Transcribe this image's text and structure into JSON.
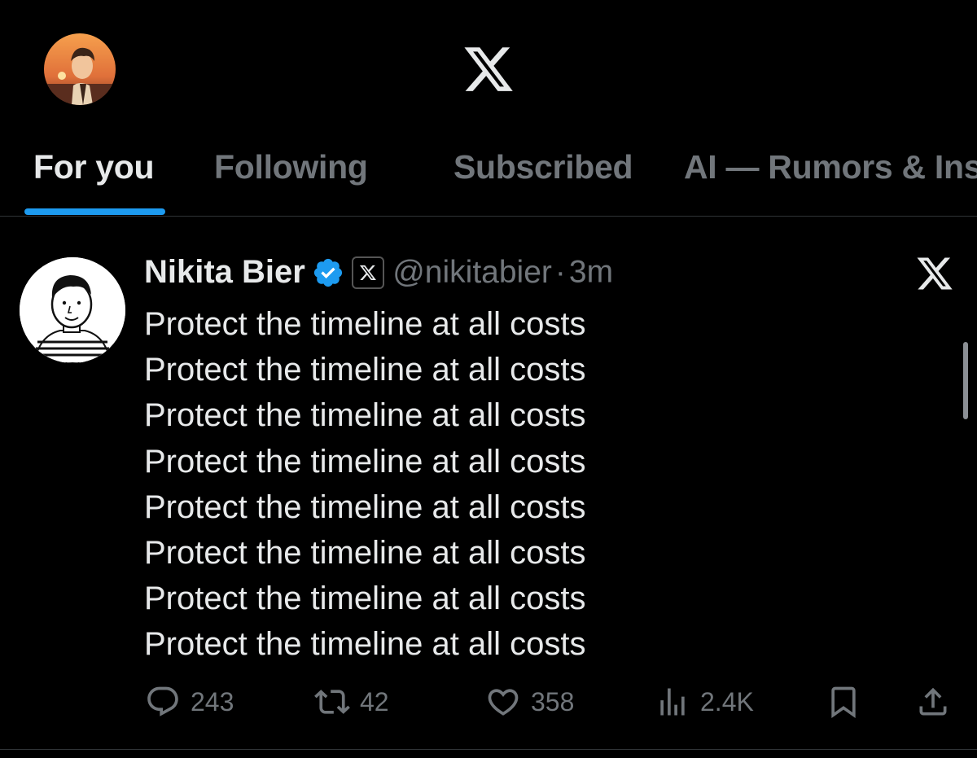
{
  "tabs": [
    {
      "label": "For you"
    },
    {
      "label": "Following"
    },
    {
      "label": "Subscribed"
    },
    {
      "label": "AI — Rumors & Ins"
    }
  ],
  "tweet": {
    "author_name": "Nikita Bier",
    "handle": "@nikitabier",
    "separator": "·",
    "time": "3m",
    "lines": [
      "Protect the timeline at all costs",
      "Protect the timeline at all costs",
      "Protect the timeline at all costs",
      "Protect the timeline at all costs",
      "Protect the timeline at all costs",
      "Protect the timeline at all costs",
      "Protect the timeline at all costs",
      "Protect the timeline at all costs"
    ],
    "actions": {
      "replies": "243",
      "reposts": "42",
      "likes": "358",
      "views": "2.4K"
    }
  },
  "icons": {
    "logo": "x-logo-icon",
    "verified": "verified-badge-icon",
    "affiliate": "x-affiliate-badge-icon",
    "grok": "x-grok-icon",
    "reply": "reply-icon",
    "repost": "repost-icon",
    "like": "heart-icon",
    "views": "views-chart-icon",
    "bookmark": "bookmark-icon",
    "share": "share-icon"
  },
  "colors": {
    "background": "#000000",
    "text": "#e7e9ea",
    "muted": "#71767b",
    "accent": "#1d9bf0",
    "divider": "#2f3336"
  }
}
